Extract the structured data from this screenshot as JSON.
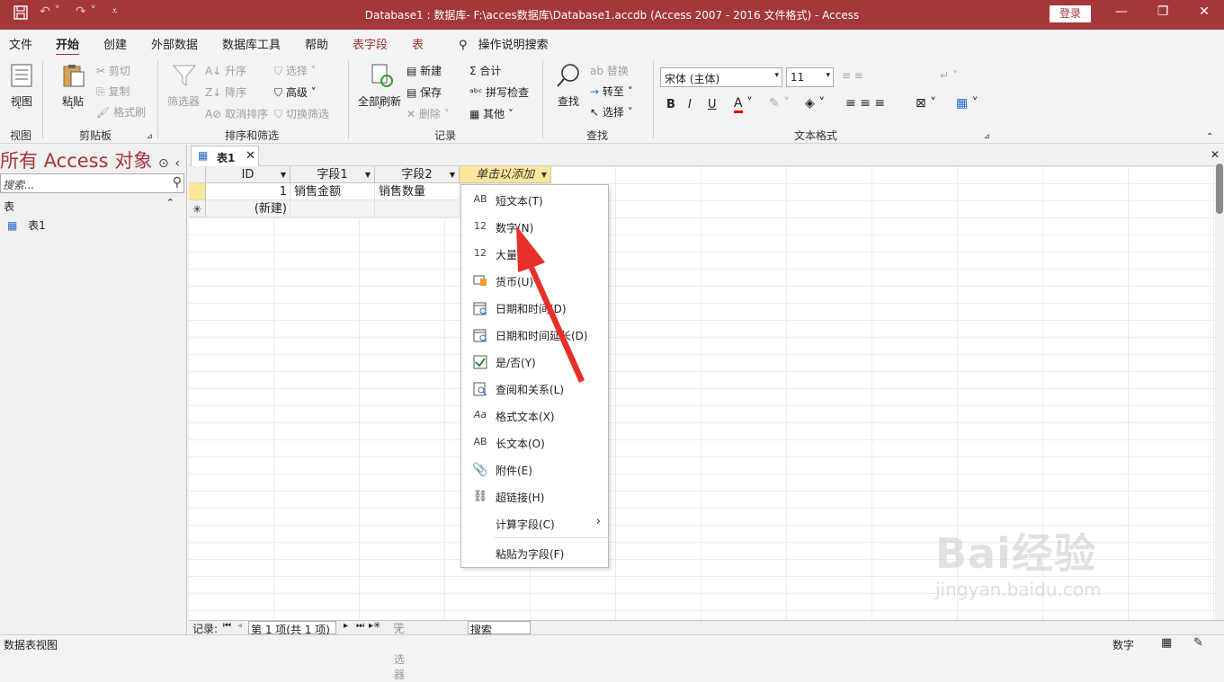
{
  "window": {
    "title": "Database1 : 数据库- F:\\acces数据库\\Database1.accdb (Access 2007 - 2016 文件格式)  -  Access",
    "login_label": "登录",
    "accent": "#a4373a"
  },
  "menu": {
    "items": [
      "文件",
      "开始",
      "创建",
      "外部数据",
      "数据库工具",
      "帮助"
    ],
    "context_tabs": [
      "表字段",
      "表"
    ],
    "search_help": "操作说明搜索"
  },
  "ribbon": {
    "groups": {
      "view": "视图",
      "clipboard": "剪贴板",
      "sort_filter": "排序和筛选",
      "records": "记录",
      "find": "查找",
      "text_format": "文本格式"
    },
    "view_button": "视图",
    "paste": "粘贴",
    "cut": "剪切",
    "copy": "复制",
    "format_painter": "格式刷",
    "filter": "筛选器",
    "ascending": "升序",
    "descending": "降序",
    "remove_sort": "取消排序",
    "selection": "选择",
    "advanced": "高级",
    "toggle_filter": "切换筛选",
    "refresh_all": "全部刷新",
    "new": "新建",
    "save": "保存",
    "delete": "删除",
    "totals": "合计",
    "spelling": "拼写检查",
    "more": "其他",
    "find": "查找",
    "replace": "替换",
    "goto": "转至",
    "select": "选择",
    "font_name": "宋体 (主体)",
    "font_size": "11",
    "bold": "B",
    "italic": "I",
    "underline": "U"
  },
  "nav": {
    "title": "所有 Access 对象",
    "search_placeholder": "搜索...",
    "section": "表",
    "items": [
      "表1"
    ]
  },
  "document": {
    "tab_label": "表1",
    "columns": [
      "ID",
      "字段1",
      "字段2",
      "单击以添加"
    ],
    "rows": [
      {
        "id": "1",
        "f1": "销售金额",
        "f2": "销售数量"
      }
    ],
    "new_row_label": "(新建)"
  },
  "dropdown": {
    "items": [
      {
        "icon": "AB",
        "label": "短文本(T)"
      },
      {
        "icon": "12",
        "label": "数字(N)"
      },
      {
        "icon": "12",
        "label": "大量"
      },
      {
        "icon": "currency-icon",
        "label": "货币(U)"
      },
      {
        "icon": "calendar-icon",
        "label": "日期和时间(D)"
      },
      {
        "icon": "calendar-icon",
        "label": "日期和时间延长(D)"
      },
      {
        "icon": "checkbox-icon",
        "label": "是/否(Y)"
      },
      {
        "icon": "lookup-icon",
        "label": "查阅和关系(L)"
      },
      {
        "icon": "Aa",
        "label": "格式文本(X)"
      },
      {
        "icon": "AB",
        "label": "长文本(O)"
      },
      {
        "icon": "paperclip-icon",
        "label": "附件(E)"
      },
      {
        "icon": "link-icon",
        "label": "超链接(H)"
      },
      {
        "icon": "",
        "label": "计算字段(C)"
      },
      {
        "icon": "",
        "label": "粘贴为字段(F)"
      }
    ]
  },
  "record_nav": {
    "label": "记录:",
    "position": "第 1 项(共 1 项)",
    "filter": "无筛选器",
    "search": "搜索"
  },
  "status": {
    "left": "数据表视图",
    "right": "数字"
  },
  "watermark": {
    "brand": "Bai经验",
    "url": "jingyan.baidu.com"
  }
}
